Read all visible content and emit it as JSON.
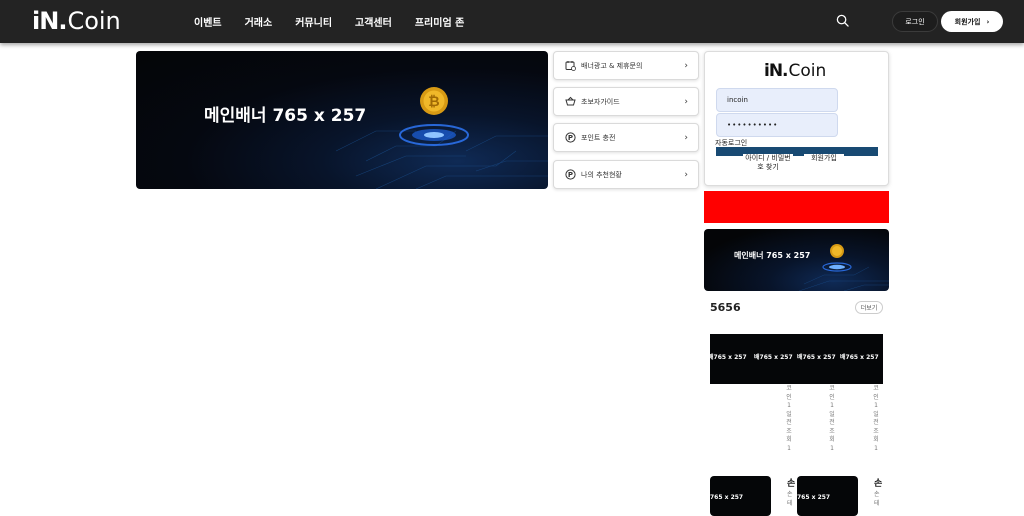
{
  "header": {
    "logo_mark": "iN.",
    "logo_word": "Coin",
    "nav": [
      "이벤트",
      "거래소",
      "커뮤니티",
      "고객센터",
      "프리미엄 존"
    ],
    "login_label": "로그인",
    "join_label": "회원가입",
    "join_chevron": "›",
    "bg_color": "#232323"
  },
  "main_banner": {
    "text": "메인배너 765 x 257"
  },
  "menu": [
    {
      "icon": "calendar-icon",
      "label": "배너광고 & 제휴문의",
      "chevron": "›"
    },
    {
      "icon": "basket-icon",
      "label": "초보자가이드",
      "chevron": "›"
    },
    {
      "icon": "point-icon",
      "label": "포인트 충전",
      "chevron": "›"
    },
    {
      "icon": "point-icon",
      "label": "나의 추천현황",
      "chevron": "›"
    }
  ],
  "login_panel": {
    "logo_mark": "iN.",
    "logo_word": "Coin",
    "id_value": "incoin",
    "password_value": "••••••••••",
    "auto_login": "자동로그인",
    "find_link": "아이디 / 비밀번호 찾기",
    "join_link": "회원가입",
    "bar_color": "#184a73"
  },
  "red_block_color": "#ff0000",
  "side_banner": {
    "text": "메인배너 765 x 257"
  },
  "section": {
    "title": "5656",
    "more": "더보기"
  },
  "strip_labels": [
    "765 x 257",
    "765 x 257",
    "765 x 257",
    "765 x 257"
  ],
  "vertical_texts": [
    "코인1일전조회1",
    "코인1일전조회1",
    "코인1일전조회1"
  ],
  "thumbs": [
    {
      "label": "765 x 257",
      "side_title": "손",
      "side_sub": "손\n테"
    },
    {
      "label": "765 x 257",
      "side_title": "손",
      "side_sub": "손\n테"
    }
  ]
}
